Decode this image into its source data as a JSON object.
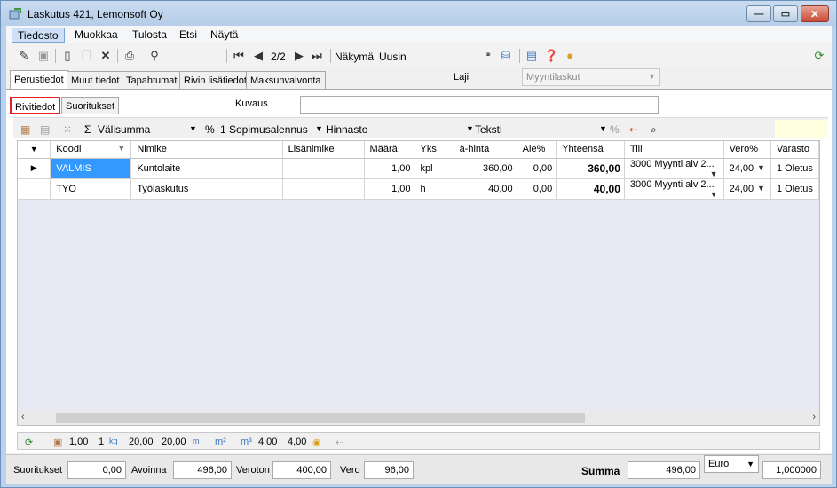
{
  "window": {
    "title": "Laskutus 421, Lemonsoft Oy"
  },
  "menu": [
    "Tiedosto",
    "Muokkaa",
    "Tulosta",
    "Etsi",
    "Näytä"
  ],
  "toolbar": {
    "record_position": "2/2",
    "view_label": "Näkymä",
    "view_value": "Uusin"
  },
  "tabs_main": [
    "Perustiedot",
    "Muut tiedot",
    "Tapahtumat",
    "Rivin lisätiedot",
    "Maksunvalvonta"
  ],
  "laji": {
    "label": "Laji",
    "value": "Myyntilaskut"
  },
  "tabs_sub": [
    "Rivitiedot",
    "Suoritukset"
  ],
  "kuvaus": {
    "label": "Kuvaus",
    "value": ""
  },
  "gridbar": {
    "subtotal": "Välisumma",
    "discount": "1 Sopimusalennus",
    "pricelist": "Hinnasto",
    "text": "Teksti"
  },
  "columns": [
    "Koodi",
    "Nimike",
    "Lisänimike",
    "Määrä",
    "Yks",
    "à-hinta",
    "Ale%",
    "Yhteensä",
    "Tili",
    "Vero%",
    "Varasto"
  ],
  "rows": [
    {
      "koodi": "VALMIS",
      "nimike": "Kuntolaite",
      "lisanimike": "",
      "maara": "1,00",
      "yks": "kpl",
      "ahinta": "360,00",
      "ale": "0,00",
      "yhteensa": "360,00",
      "tili": "3000 Myynti alv 2...",
      "vero": "24,00",
      "varasto": "1 Oletus"
    },
    {
      "koodi": "TYO",
      "nimike": "Työlaskutus",
      "lisanimike": "",
      "maara": "1,00",
      "yks": "h",
      "ahinta": "40,00",
      "ale": "0,00",
      "yhteensa": "40,00",
      "tili": "3000 Myynti alv 2...",
      "vero": "24,00",
      "varasto": "1 Oletus"
    }
  ],
  "statusbar": {
    "v1": "1,00",
    "v2": "1",
    "kg_label": "kg",
    "v3": "20,00",
    "v4": "20,00",
    "m_label": "m",
    "m2_label": "m²",
    "m3_label": "m³",
    "v5": "4,00",
    "v6": "4,00"
  },
  "footer": {
    "suoritukset_label": "Suoritukset",
    "suoritukset": "0,00",
    "avoinna_label": "Avoinna",
    "avoinna": "496,00",
    "veroton_label": "Veroton",
    "veroton": "400,00",
    "vero_label": "Vero",
    "vero": "96,00",
    "summa_label": "Summa",
    "summa": "496,00",
    "currency": "Euro",
    "rate": "1,000000"
  }
}
